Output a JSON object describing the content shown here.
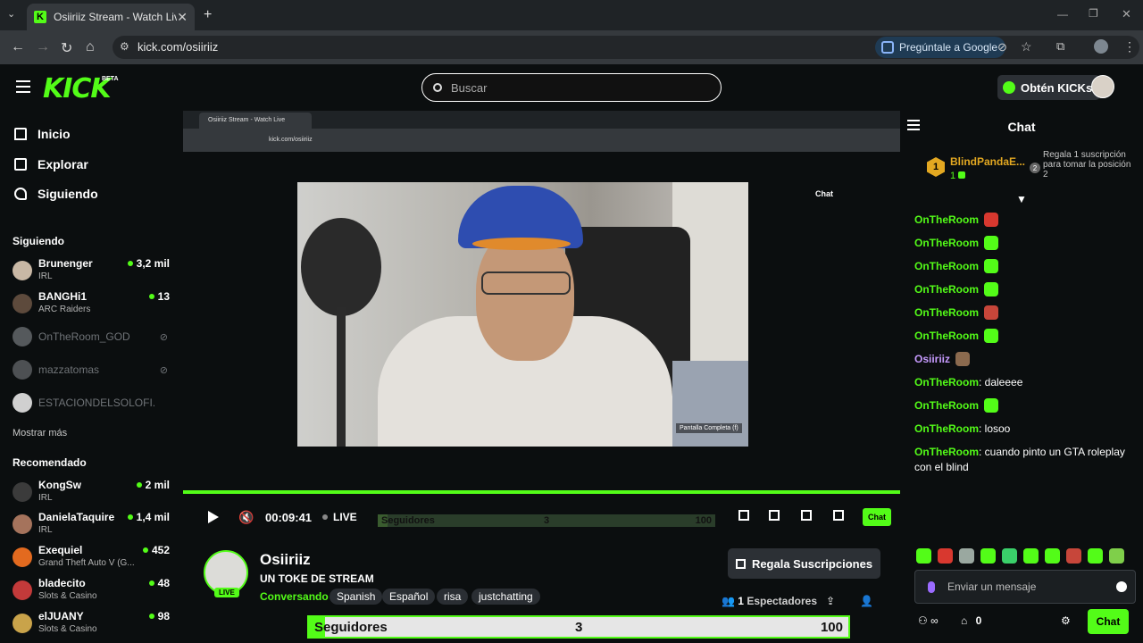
{
  "browser": {
    "tab_title": "Osiiriiz Stream - Watch Live on",
    "tab_close": "✕",
    "new_tab": "+",
    "url": "kick.com/osiiriiz",
    "ask_google": "Pregúntale a Google"
  },
  "header": {
    "logo": "KICK",
    "logo_badge": "BETA",
    "search_placeholder": "Buscar",
    "kicks_label": "Obtén KICKs"
  },
  "sidebar": {
    "nav": [
      {
        "label": "Inicio"
      },
      {
        "label": "Explorar"
      },
      {
        "label": "Siguiendo"
      }
    ],
    "following_title": "Siguiendo",
    "following": [
      {
        "name": "Brunenger",
        "category": "IRL",
        "viewers": "3,2 mil",
        "online": true
      },
      {
        "name": "BANGHi1",
        "category": "ARC Raiders",
        "viewers": "13",
        "online": true
      },
      {
        "name": "OnTheRoom_GOD",
        "online": false
      },
      {
        "name": "mazzatomas",
        "online": false
      },
      {
        "name": "ESTACIONDELSOLOFI...",
        "online": false
      }
    ],
    "show_more": "Mostrar más",
    "recommended_title": "Recomendado",
    "recommended": [
      {
        "name": "KongSw",
        "category": "IRL",
        "viewers": "2 mil"
      },
      {
        "name": "DanielaTaquire",
        "category": "IRL",
        "viewers": "1,4 mil"
      },
      {
        "name": "Exequiel",
        "category": "Grand Theft Auto V (G...",
        "viewers": "452"
      },
      {
        "name": "bladecito",
        "category": "Slots & Casino",
        "viewers": "48"
      },
      {
        "name": "elJUANY",
        "category": "Slots & Casino",
        "viewers": "98"
      }
    ]
  },
  "player": {
    "inner_tab_title": "Osiiriiz Stream - Watch Live",
    "inner_url": "kick.com/osiiriiz",
    "inner_chat_title": "Chat",
    "fullscreen_tip": "Pantalla Completa (f)",
    "time": "00:09:41",
    "live": "LIVE",
    "chat_button": "Chat",
    "followers_goal": {
      "label": "Seguidores",
      "current": "3",
      "target": "100",
      "progress": 0.03
    }
  },
  "stream": {
    "streamer": "Osiiriiz",
    "live_badge": "LIVE",
    "title": "UN TOKE DE STREAM",
    "category": "Conversando",
    "tags": [
      "Spanish",
      "Español",
      "risa",
      "justchatting"
    ],
    "gift_button": "Regala Suscripciones",
    "viewers_count": "1",
    "viewers_label": "Espectadores"
  },
  "chat": {
    "title": "Chat",
    "top_donor": {
      "rank": "1",
      "name": "BlindPandaE...",
      "amount": "1"
    },
    "donor_cta": "Regala 1 suscripción para tomar la posición 2",
    "donor_cta_rank": "2",
    "messages": [
      {
        "user": "OnTheRoom",
        "text": "",
        "emote": "#d8382f"
      },
      {
        "user": "OnTheRoom",
        "text": "",
        "emote": "#53fc18"
      },
      {
        "user": "OnTheRoom",
        "text": "",
        "emote": "#53fc18"
      },
      {
        "user": "OnTheRoom",
        "text": "",
        "emote": "#53fc18"
      },
      {
        "user": "OnTheRoom",
        "text": "",
        "emote": "#c7463a"
      },
      {
        "user": "OnTheRoom",
        "text": "",
        "emote": "#53fc18"
      },
      {
        "user": "Osiiriiz",
        "text": "",
        "emote": "#8b6a4e"
      },
      {
        "user": "OnTheRoom",
        "text": ": daleeee"
      },
      {
        "user": "OnTheRoom",
        "text": "",
        "emote": "#53fc18"
      },
      {
        "user": "OnTheRoom",
        "text": ": losoo"
      },
      {
        "user": "OnTheRoom",
        "text": ": cuando pinto un GTA roleplay con el blind"
      }
    ],
    "input_placeholder": "Enviar un mensaje",
    "kicks_count": "0",
    "send_button": "Chat"
  }
}
